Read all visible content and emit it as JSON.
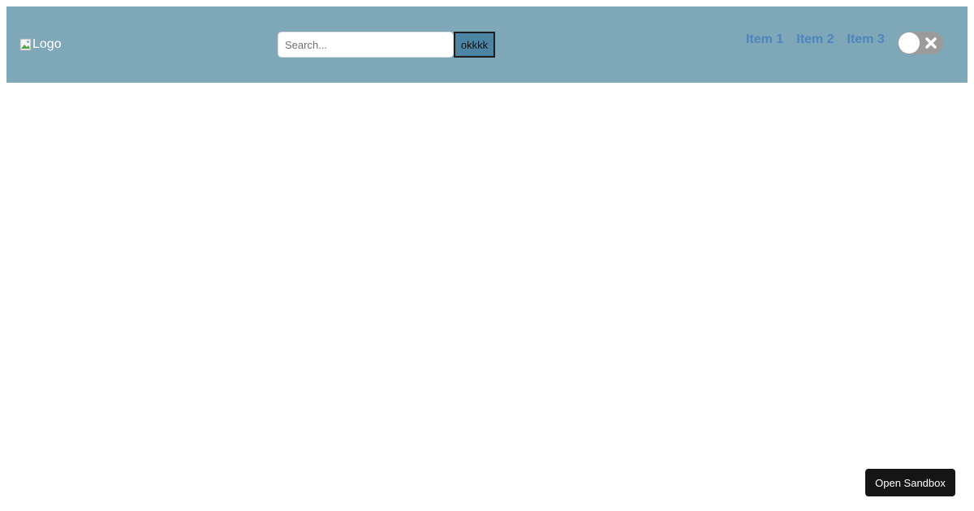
{
  "header": {
    "logo_alt": "Logo",
    "search": {
      "placeholder": "Search...",
      "value": "",
      "button_label": "okkkk"
    },
    "nav_items": [
      {
        "label": "Item 1"
      },
      {
        "label": "Item 2"
      },
      {
        "label": "Item 3"
      }
    ],
    "toggle": {
      "state": "off",
      "icon": "close-icon"
    }
  },
  "footer": {
    "sandbox_button_label": "Open Sandbox"
  },
  "colors": {
    "navbar_bg": "#7ea7b8",
    "nav_link": "#4d86bd",
    "search_button_bg": "#4c84a4",
    "toggle_track": "#9b9b9b",
    "sandbox_button_bg": "#151515"
  }
}
